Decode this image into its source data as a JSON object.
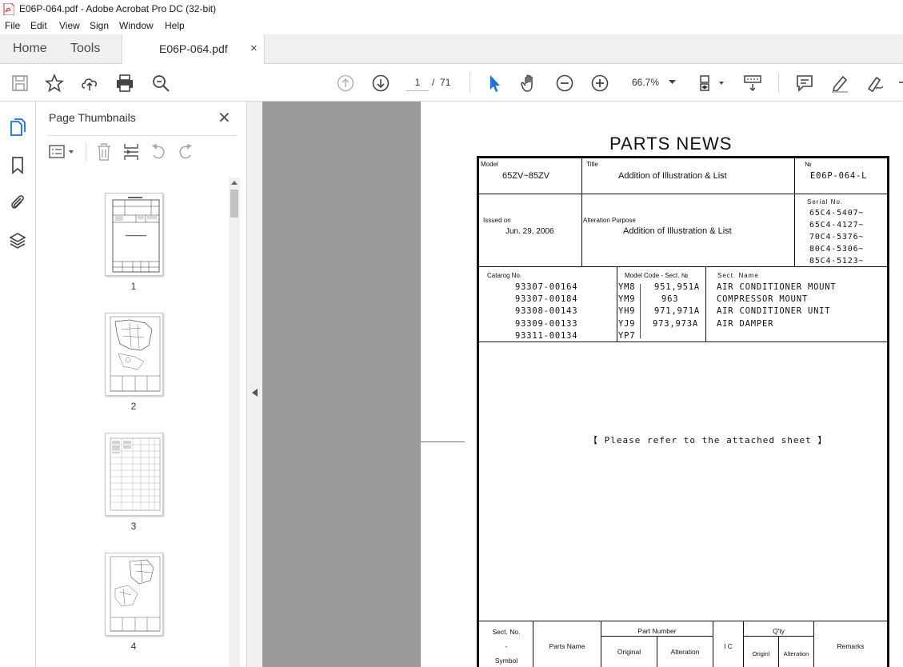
{
  "window": {
    "title": "E06P-064.pdf - Adobe Acrobat Pro DC (32-bit)"
  },
  "menu": [
    "File",
    "Edit",
    "View",
    "Sign",
    "Window",
    "Help"
  ],
  "tabs": {
    "home": "Home",
    "tools": "Tools",
    "document": "E06P-064.pdf",
    "close": "×"
  },
  "toolbar": {
    "page_current": "1",
    "page_sep": "/",
    "page_total": "71",
    "zoom": "66.7%"
  },
  "colors": {
    "accent": "#1473e6",
    "acrobat_red": "#d7282f"
  },
  "panel": {
    "title": "Page Thumbnails",
    "close": "✕",
    "thumbnails": [
      {
        "label": "1"
      },
      {
        "label": "2"
      },
      {
        "label": "3"
      },
      {
        "label": "4"
      }
    ]
  },
  "document": {
    "heading": "PARTS NEWS",
    "model_label": "Model",
    "model_value": "65ZV~85ZV",
    "title_label": "Title",
    "title_value": "Addition  of  Illustration  &  List",
    "no_label": "№",
    "no_value": "E06P-064-L",
    "issued_label": "Issued on",
    "issued_value": "Jun. 29, 2006",
    "alteration_label": "Alteration Purpose",
    "alteration_value": "Addition  of  Illustration  &  List",
    "serial_label": "Serial No.",
    "serials": [
      "65C4-5407~",
      "65C4-4127~",
      "70C4-5376~",
      "80C4-5306~",
      "85C4-5123~"
    ],
    "catalog_label": "Catarog  No.",
    "catalog_numbers": [
      "93307-00164",
      "93307-00184",
      "93308-00143",
      "93309-00133",
      "93311-00134"
    ],
    "model_code_label": "Model Code - Sect. №",
    "model_codes": [
      "YM8",
      "YM9",
      "YH9",
      "YJ9",
      "YP7"
    ],
    "sect_numbers": [
      "951,951A",
      "963",
      "971,971A",
      "973,973A"
    ],
    "sect_name_label": "Sect. Name",
    "sect_names": [
      "AIR CONDITIONER MOUNT",
      "COMPRESSOR MOUNT",
      "AIR CONDITIONER UNIT",
      "AIR DAMPER"
    ],
    "note": "【 Please refer to the attached sheet 】",
    "bottom": {
      "sect_no": "Sect. No.",
      "dash": "-",
      "symbol": "Symbol",
      "parts_name": "Parts Name",
      "part_number": "Part Number",
      "original": "Original",
      "alteration": "Alteration",
      "ic": "I C",
      "qty": "Q'ty",
      "qty_original": "Originl",
      "qty_alteration": "Alteration",
      "remarks": "Remarks"
    }
  }
}
